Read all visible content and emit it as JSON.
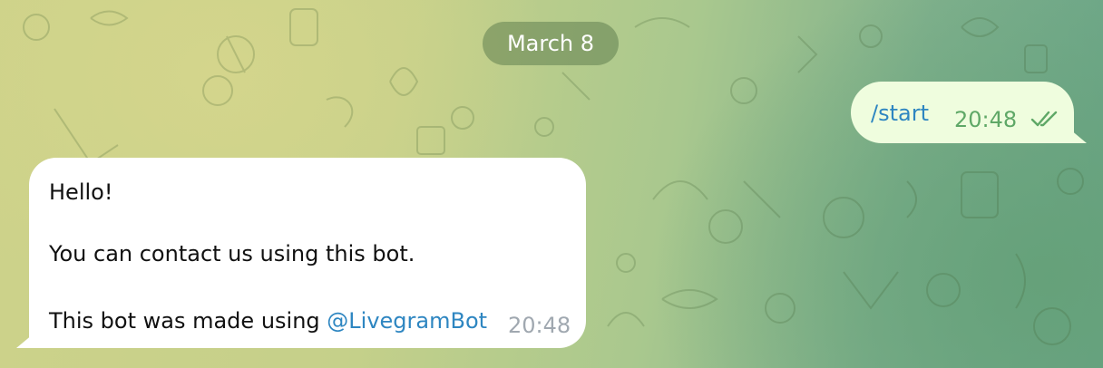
{
  "date_separator": {
    "label": "March 8"
  },
  "messages": {
    "outgoing": {
      "text": "/start",
      "time": "20:48",
      "status_icon": "double-check-icon"
    },
    "incoming": {
      "greeting": "Hello!",
      "body": "You can contact us using this bot.",
      "footer_prefix": "This bot was made using ",
      "mention": "@LivegramBot",
      "time": "20:48"
    }
  },
  "colors": {
    "outgoing_bubble": "#effdde",
    "incoming_bubble": "#ffffff",
    "link": "#2e86c1",
    "outgoing_time": "#5fa867",
    "incoming_time": "#a0a8b0"
  }
}
